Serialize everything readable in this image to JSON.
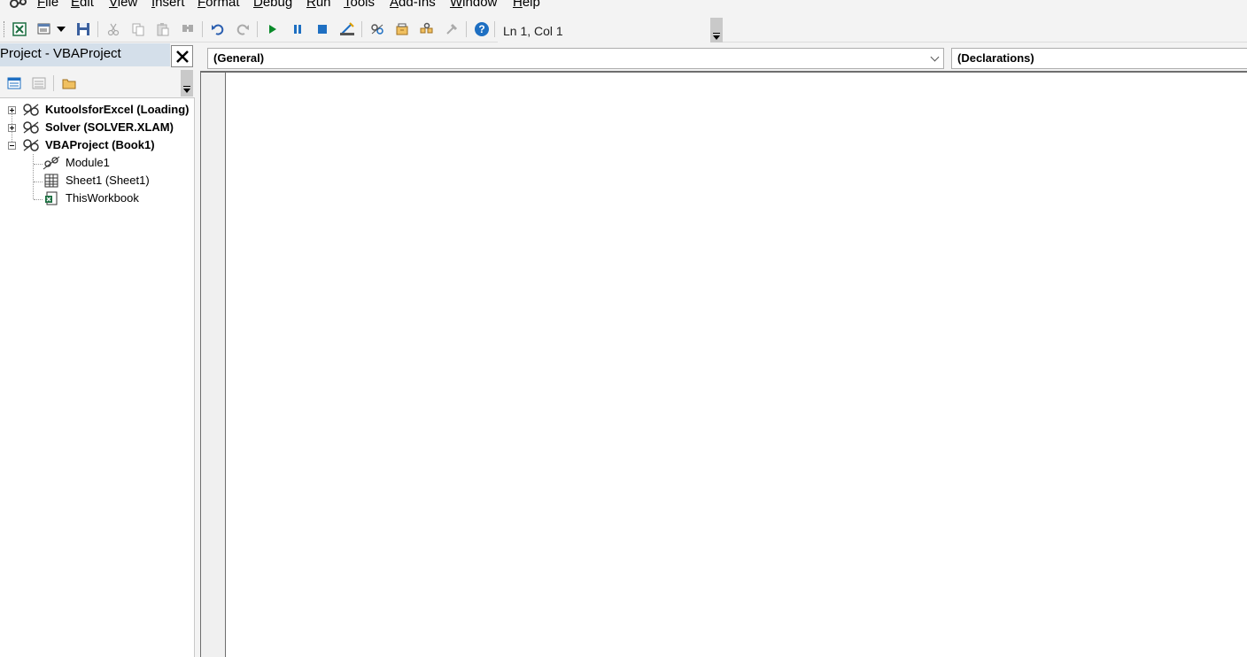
{
  "menu": {
    "items": [
      {
        "key": "F",
        "rest": "ile"
      },
      {
        "key": "E",
        "rest": "dit"
      },
      {
        "key": "V",
        "rest": "iew"
      },
      {
        "key": "I",
        "rest": "nsert"
      },
      {
        "key": "F",
        "rest": "ormat"
      },
      {
        "key": "D",
        "rest": "ebug"
      },
      {
        "key": "R",
        "rest": "un"
      },
      {
        "key": "T",
        "rest": "ools"
      },
      {
        "key": "A",
        "rest": "dd-Ins"
      },
      {
        "key": "W",
        "rest": "indow"
      },
      {
        "key": "H",
        "rest": "elp"
      }
    ]
  },
  "toolbar": {
    "icons": [
      "view-excel-icon",
      "insert-module-icon",
      "dropdown-arrow-icon",
      "save-icon",
      "cut-icon",
      "copy-icon",
      "paste-icon",
      "find-icon",
      "undo-icon",
      "redo-icon",
      "run-icon",
      "break-icon",
      "reset-icon",
      "design-mode-icon",
      "project-explorer-icon",
      "properties-window-icon",
      "object-browser-icon",
      "toolbox-icon",
      "help-icon"
    ],
    "cursor_position": "Ln 1, Col 1"
  },
  "project_explorer": {
    "title": "Project - VBAProject",
    "close_glyph": "✕",
    "tree": [
      {
        "label": "KutoolsforExcel (Loading)",
        "bold": true,
        "expanded": false
      },
      {
        "label": "Solver (SOLVER.XLAM)",
        "bold": true,
        "expanded": false
      },
      {
        "label": "VBAProject (Book1)",
        "bold": true,
        "expanded": true
      },
      {
        "label": "Module1",
        "bold": false,
        "icon": "module-icon"
      },
      {
        "label": "Sheet1 (Sheet1)",
        "bold": false,
        "icon": "worksheet-icon"
      },
      {
        "label": "ThisWorkbook",
        "bold": false,
        "icon": "workbook-icon"
      }
    ]
  },
  "code_window": {
    "object_combo": "(General)",
    "procedure_combo": "(Declarations)"
  },
  "colors": {
    "title_bar_active": "#d4dfea",
    "help_blue": "#1e6fc2",
    "run_green": "#0a8a2a"
  }
}
